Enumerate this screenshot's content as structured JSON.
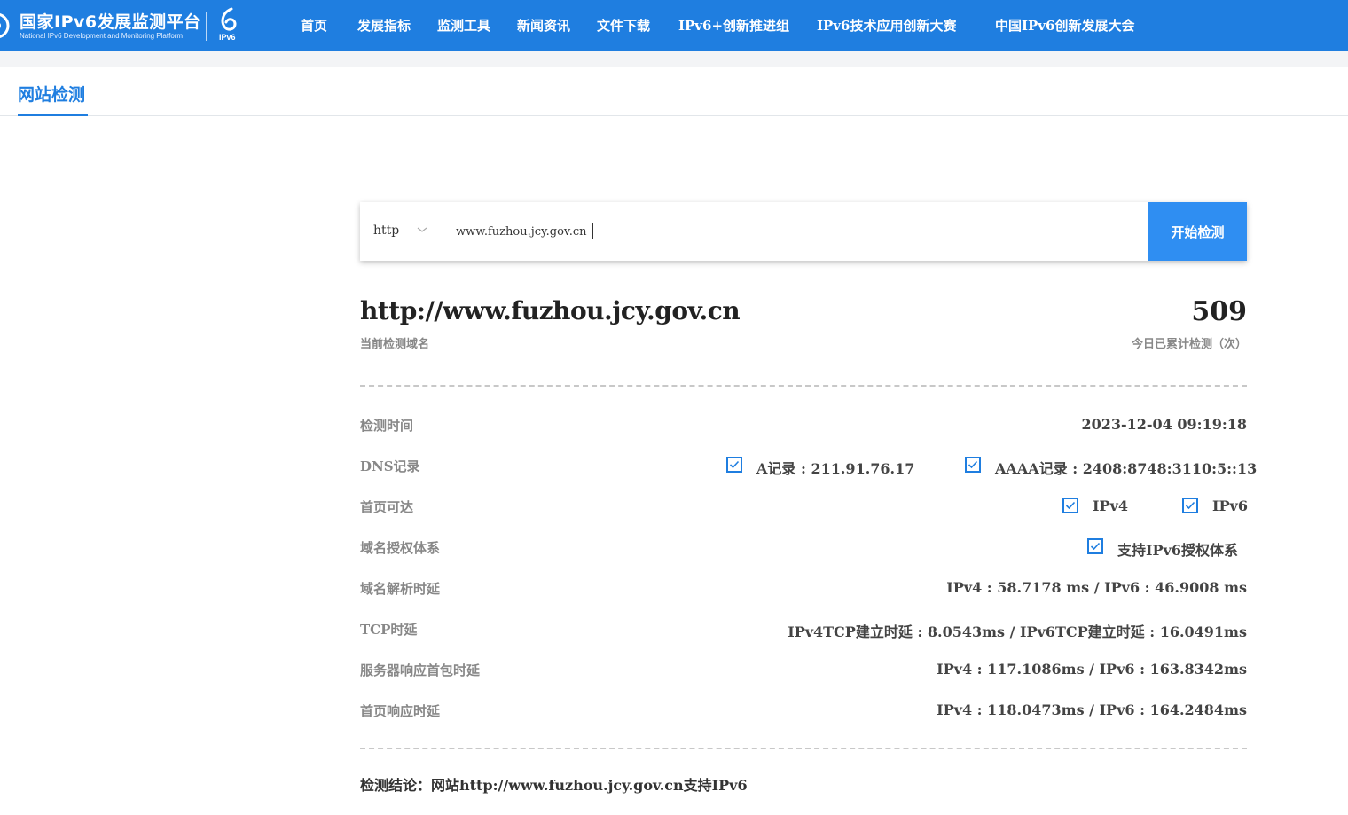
{
  "header": {
    "brand_cn": "国家IPv6发展监测平台",
    "brand_en": "National IPv6 Development and Monitoring Platform",
    "badge_label": "IPv6",
    "nav": [
      "首页",
      "发展指标",
      "监测工具",
      "新闻资讯",
      "文件下载",
      "IPv6+创新推进组",
      "IPv6技术应用创新大赛",
      "中国IPv6创新发展大会"
    ]
  },
  "tabs": {
    "active": "网站检测"
  },
  "search": {
    "protocol": "http",
    "url_value": "www.fuzhou.jcy.gov.cn",
    "button_label": "开始检测"
  },
  "result": {
    "domain": "http://www.fuzhou.jcy.gov.cn",
    "domain_label": "当前检测域名",
    "count": "509",
    "count_label": "今日已累计检测（次）",
    "rows": {
      "check_time": {
        "label": "检测时间",
        "value": "2023-12-04 09:19:18"
      },
      "dns": {
        "label": "DNS记录",
        "a_record": "A记录 : 211.91.76.17",
        "aaaa_record": "AAAA记录 : 2408:8748:3110:5::13"
      },
      "homepage": {
        "label": "首页可达",
        "ipv4": "IPv4",
        "ipv6": "IPv6"
      },
      "auth": {
        "label": "域名授权体系",
        "value": "支持IPv6授权体系"
      },
      "dns_latency": {
        "label": "域名解析时延",
        "value": "IPv4 : 58.7178 ms / IPv6 : 46.9008 ms"
      },
      "tcp_latency": {
        "label": "TCP时延",
        "value": "IPv4TCP建立时延 : 8.0543ms / IPv6TCP建立时延 : 16.0491ms"
      },
      "first_packet": {
        "label": "服务器响应首包时延",
        "value": "IPv4 : 117.1086ms / IPv6 : 163.8342ms"
      },
      "homepage_latency": {
        "label": "首页响应时延",
        "value": "IPv4 : 118.0473ms / IPv6 : 164.2484ms"
      }
    },
    "conclusion": "检测结论：网站http://www.fuzhou.jcy.gov.cn支持IPv6"
  },
  "colors": {
    "brand_blue": "#1f7ee0",
    "button_blue": "#2f8ef2"
  }
}
